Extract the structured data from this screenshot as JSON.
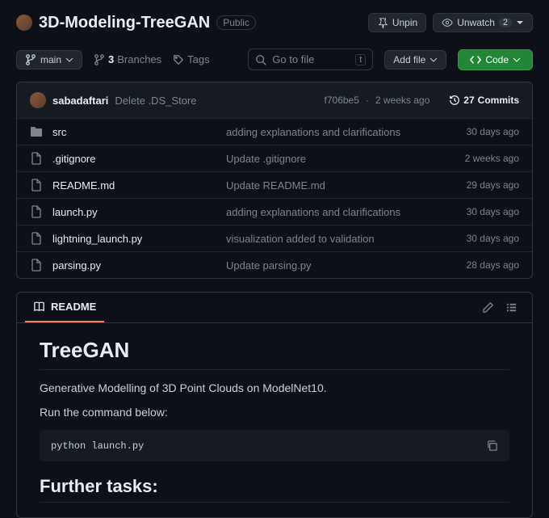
{
  "header": {
    "repo": "3D-Modeling-TreeGAN",
    "visibility": "Public",
    "unpin": "Unpin",
    "unwatch": "Unwatch",
    "watch_count": "2"
  },
  "toolbar": {
    "branch": "main",
    "branches_count": "3",
    "branches_label": "Branches",
    "tags_label": "Tags",
    "search_placeholder": "Go to file",
    "shortcut": "t",
    "add_file": "Add file",
    "code": "Code"
  },
  "latest": {
    "user": "sabadaftari",
    "msg": "Delete .DS_Store",
    "sha": "f706be5",
    "time": "2 weeks ago",
    "commits_count": "27",
    "commits_label": "Commits"
  },
  "files": [
    {
      "type": "dir",
      "name": "src",
      "msg": "adding explanations and clarifications",
      "time": "30 days ago"
    },
    {
      "type": "file",
      "name": ".gitignore",
      "msg": "Update .gitignore",
      "time": "2 weeks ago"
    },
    {
      "type": "file",
      "name": "README.md",
      "msg": "Update README.md",
      "time": "29 days ago"
    },
    {
      "type": "file",
      "name": "launch.py",
      "msg": "adding explanations and clarifications",
      "time": "30 days ago"
    },
    {
      "type": "file",
      "name": "lightning_launch.py",
      "msg": "visualization added to validation",
      "time": "30 days ago"
    },
    {
      "type": "file",
      "name": "parsing.py",
      "msg": "Update parsing.py",
      "time": "28 days ago"
    }
  ],
  "readme": {
    "tab": "README",
    "h1": "TreeGAN",
    "p1": "Generative Modelling of 3D Point Clouds on ModelNet10.",
    "p2": "Run the command below:",
    "code": "python launch.py",
    "h2": "Further tasks:"
  }
}
